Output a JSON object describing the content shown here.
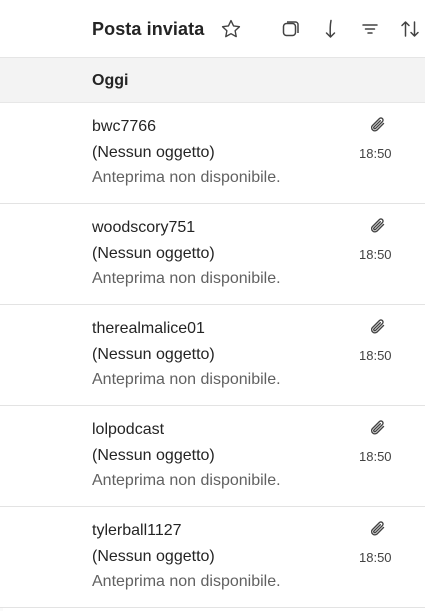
{
  "header": {
    "title": "Posta inviata",
    "icons": [
      "star-icon",
      "select-icon",
      "jump-to-icon",
      "filter-icon",
      "sort-icon"
    ]
  },
  "section": {
    "label": "Oggi"
  },
  "messages": [
    {
      "sender": "bwc7766",
      "subject": "(Nessun oggetto)",
      "preview": "Anteprima non disponibile.",
      "time": "18:50",
      "has_attachment": true
    },
    {
      "sender": "woodscory751",
      "subject": "(Nessun oggetto)",
      "preview": "Anteprima non disponibile.",
      "time": "18:50",
      "has_attachment": true
    },
    {
      "sender": "therealmalice01",
      "subject": "(Nessun oggetto)",
      "preview": "Anteprima non disponibile.",
      "time": "18:50",
      "has_attachment": true
    },
    {
      "sender": "lolpodcast",
      "subject": "(Nessun oggetto)",
      "preview": "Anteprima non disponibile.",
      "time": "18:50",
      "has_attachment": true
    },
    {
      "sender": "tylerball1127",
      "subject": "(Nessun oggetto)",
      "preview": "Anteprima non disponibile.",
      "time": "18:50",
      "has_attachment": true
    }
  ]
}
